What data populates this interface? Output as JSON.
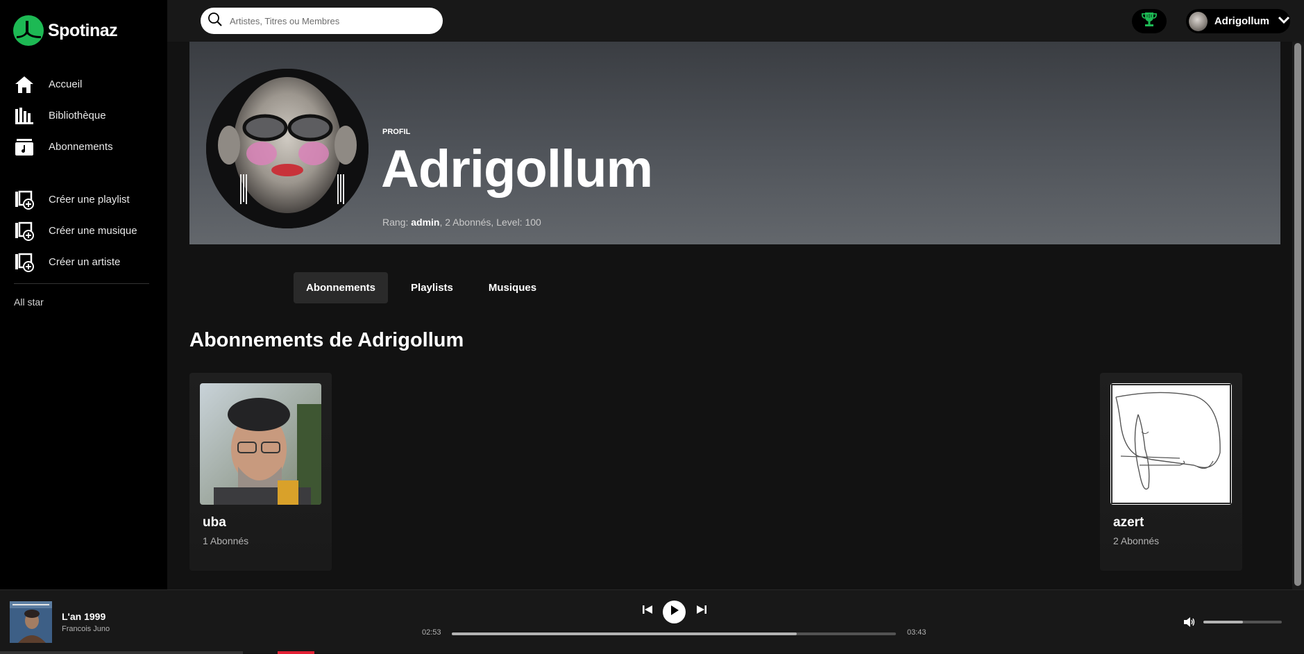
{
  "app": {
    "name": "Spotinaz"
  },
  "sidebar": {
    "primary": [
      {
        "label": "Accueil",
        "icon": "home-icon"
      },
      {
        "label": "Bibliothèque",
        "icon": "library-icon"
      },
      {
        "label": "Abonnements",
        "icon": "subscriptions-icon"
      }
    ],
    "create": [
      {
        "label": "Créer une playlist",
        "icon": "add-playlist-icon"
      },
      {
        "label": "Créer une musique",
        "icon": "add-music-icon"
      },
      {
        "label": "Créer un artiste",
        "icon": "add-artist-icon"
      }
    ],
    "extra_label": "All star"
  },
  "search": {
    "placeholder": "Artistes, Titres ou Membres",
    "value": ""
  },
  "topbar": {
    "trophy_icon": "trophy-icon",
    "user_name": "Adrigollum"
  },
  "profile": {
    "kind": "PROFIL",
    "name": "Adrigollum",
    "meta_prefix": "Rang: ",
    "rank": "admin",
    "meta_suffix": ", 2 Abonnés, Level: 100"
  },
  "tabs": [
    {
      "label": "Abonnements",
      "active": true
    },
    {
      "label": "Playlists",
      "active": false
    },
    {
      "label": "Musiques",
      "active": false
    }
  ],
  "section": {
    "title": "Abonnements de Adrigollum"
  },
  "subscriptions": [
    {
      "name": "uba",
      "subtitle": "1 Abonnés"
    },
    {
      "name": "azert",
      "subtitle": "2 Abonnés"
    }
  ],
  "player": {
    "title": "L'an 1999",
    "artist": "Francois Juno",
    "current_time": "02:53",
    "total_time": "03:43",
    "progress": 0.776,
    "volume": 0.5
  },
  "colors": {
    "accent": "#1db954",
    "background": "#121212",
    "sidebar": "#000000"
  }
}
